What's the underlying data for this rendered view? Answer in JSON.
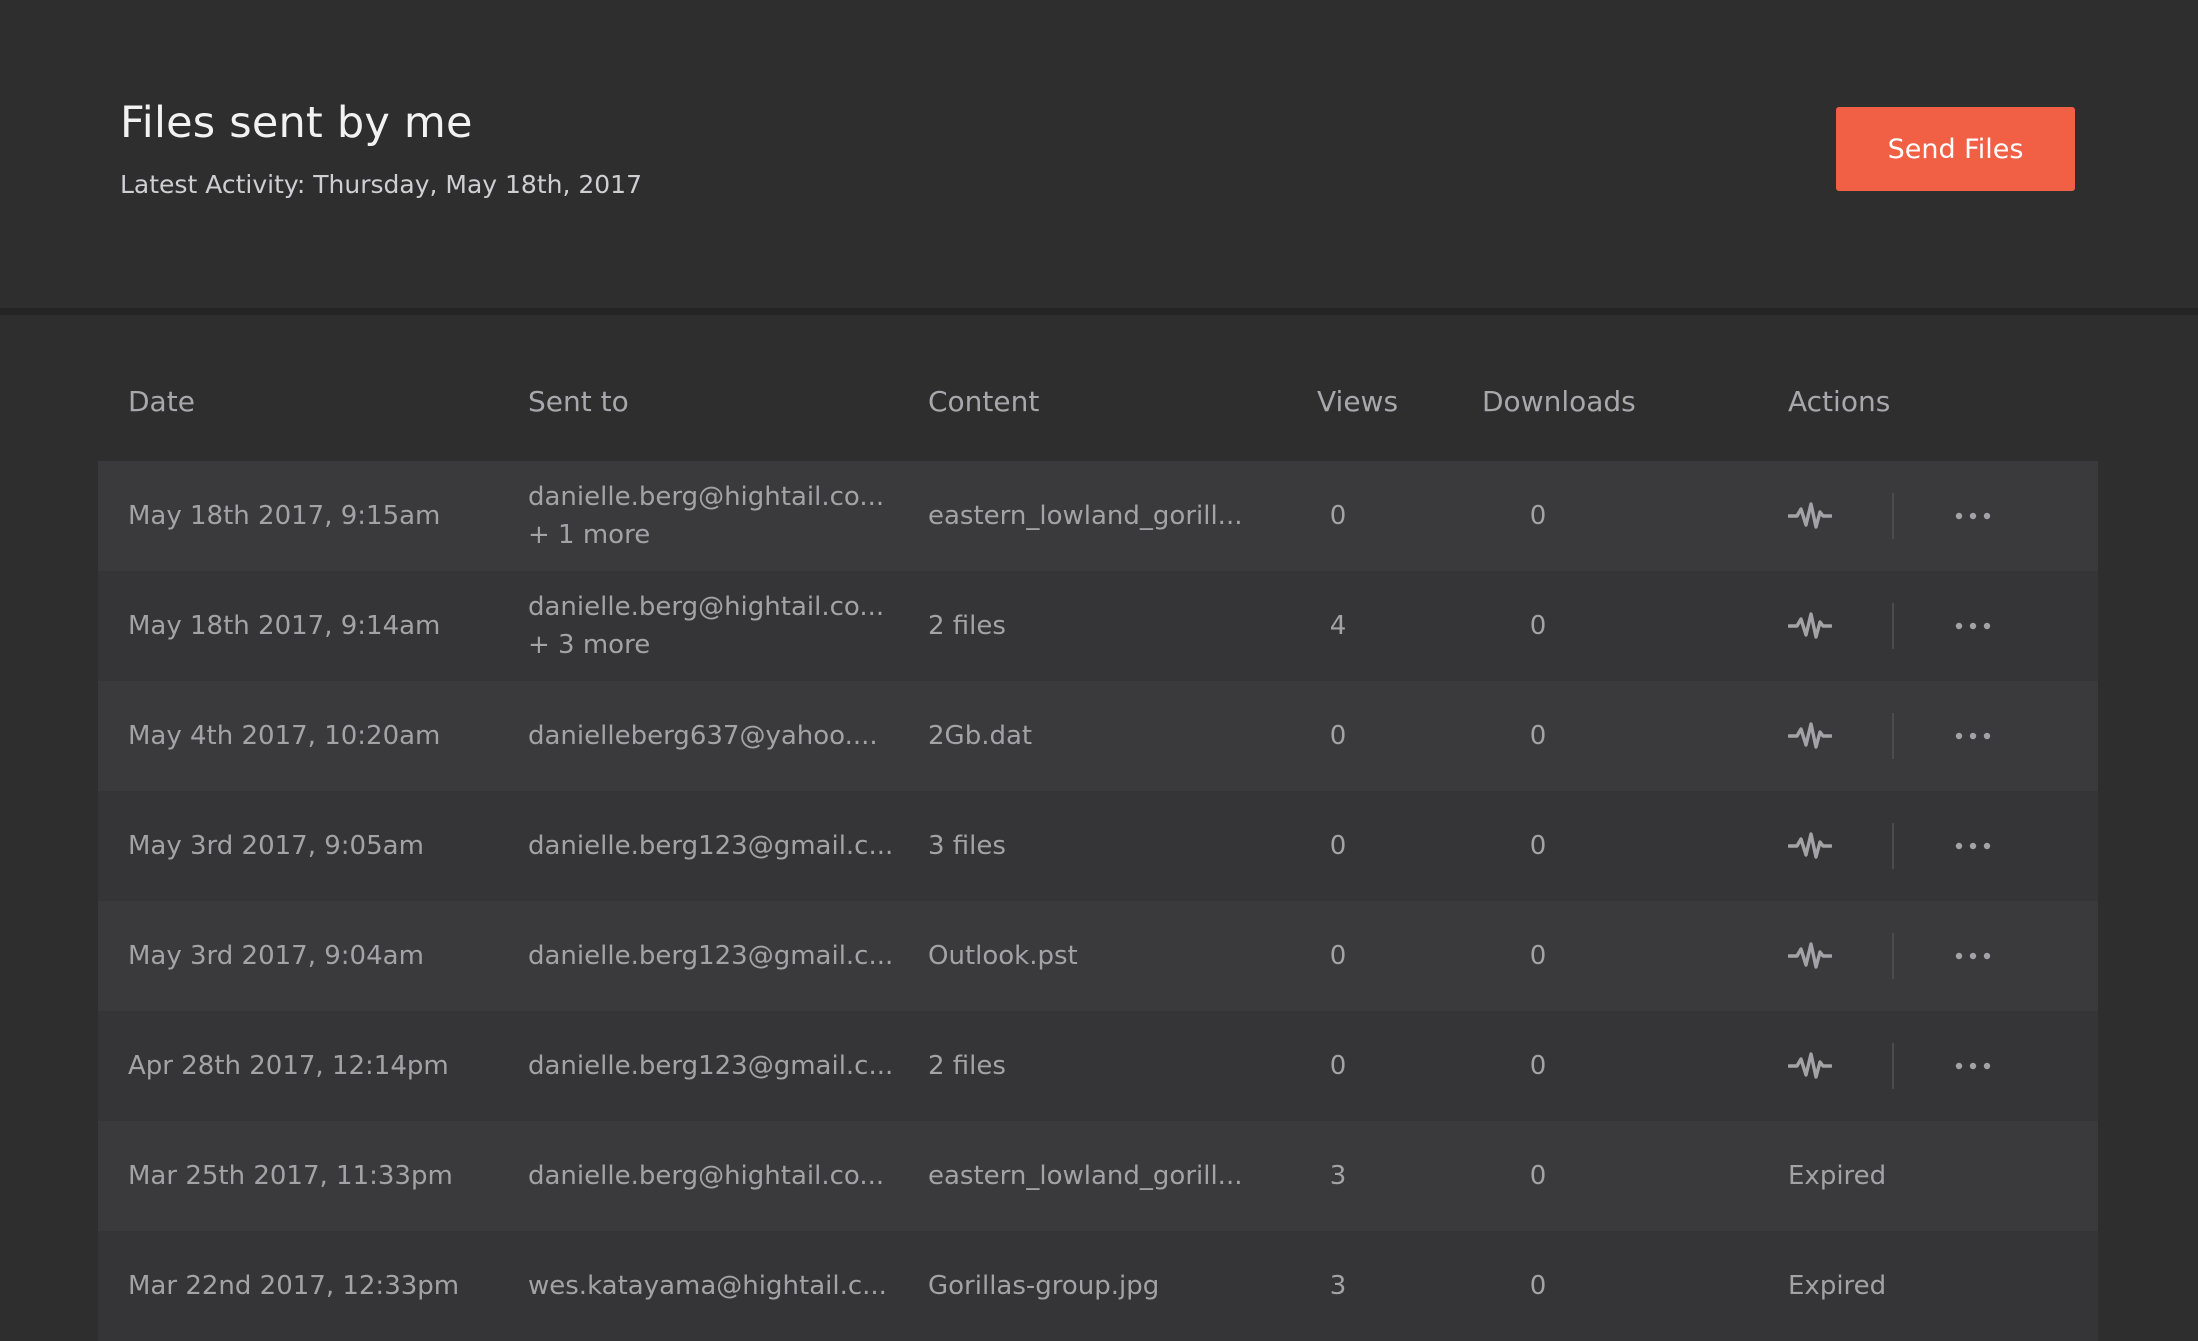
{
  "header": {
    "title": "Files sent by me",
    "subtitle": "Latest Activity: Thursday, May 18th, 2017",
    "send_button": "Send Files"
  },
  "columns": {
    "date": "Date",
    "sent_to": "Sent to",
    "content": "Content",
    "views": "Views",
    "downloads": "Downloads",
    "actions": "Actions"
  },
  "rows": [
    {
      "date": "May 18th 2017, 9:15am",
      "sent_to": "danielle.berg@hightail.co...",
      "more": "+ 1 more",
      "content": "eastern_lowland_gorill...",
      "views": "0",
      "downloads": "0",
      "status": ""
    },
    {
      "date": "May 18th 2017, 9:14am",
      "sent_to": "danielle.berg@hightail.co...",
      "more": "+ 3 more",
      "content": "2 files",
      "views": "4",
      "downloads": "0",
      "status": ""
    },
    {
      "date": "May 4th 2017, 10:20am",
      "sent_to": "danielleberg637@yahoo....",
      "more": "",
      "content": "2Gb.dat",
      "views": "0",
      "downloads": "0",
      "status": ""
    },
    {
      "date": "May 3rd 2017, 9:05am",
      "sent_to": "danielle.berg123@gmail.c...",
      "more": "",
      "content": "3 files",
      "views": "0",
      "downloads": "0",
      "status": ""
    },
    {
      "date": "May 3rd 2017, 9:04am",
      "sent_to": "danielle.berg123@gmail.c...",
      "more": "",
      "content": "Outlook.pst",
      "views": "0",
      "downloads": "0",
      "status": ""
    },
    {
      "date": "Apr 28th 2017, 12:14pm",
      "sent_to": "danielle.berg123@gmail.c...",
      "more": "",
      "content": "2 files",
      "views": "0",
      "downloads": "0",
      "status": ""
    },
    {
      "date": "Mar 25th 2017, 11:33pm",
      "sent_to": "danielle.berg@hightail.co...",
      "more": "",
      "content": "eastern_lowland_gorill...",
      "views": "3",
      "downloads": "0",
      "status": "Expired"
    },
    {
      "date": "Mar 22nd 2017, 12:33pm",
      "sent_to": "wes.katayama@hightail.c...",
      "more": "",
      "content": "Gorillas-group.jpg",
      "views": "3",
      "downloads": "0",
      "status": "Expired"
    }
  ],
  "icons": {
    "activity": "pulse-icon",
    "menu": "more-icon"
  },
  "colors": {
    "accent": "#f15f45",
    "background": "#2e2e2f"
  }
}
